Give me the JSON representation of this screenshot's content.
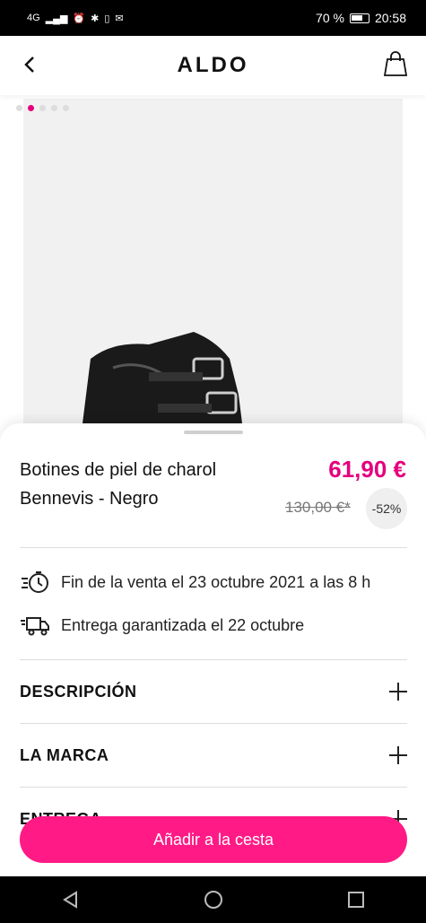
{
  "status_bar": {
    "network": "4G",
    "battery_percent": "70 %",
    "time": "20:58"
  },
  "header": {
    "logo": "ALDO"
  },
  "gallery": {
    "total_images": 5,
    "active_index": 1
  },
  "product": {
    "title": "Botines de piel de charol Bennevis - Negro",
    "price": "61,90 €",
    "old_price": "130,00 €*",
    "discount": "-52%"
  },
  "info": {
    "sale_end": "Fin de la venta el 23 octubre 2021 a las 8 h",
    "delivery": "Entrega garantizada el 22 octubre"
  },
  "accordions": [
    {
      "label": "DESCRIPCIÓN"
    },
    {
      "label": "LA MARCA"
    },
    {
      "label": "ENTREGA"
    }
  ],
  "cta": {
    "label": "Añadir a la cesta"
  },
  "colors": {
    "accent": "#e4007c",
    "cta": "#ff1a85"
  }
}
